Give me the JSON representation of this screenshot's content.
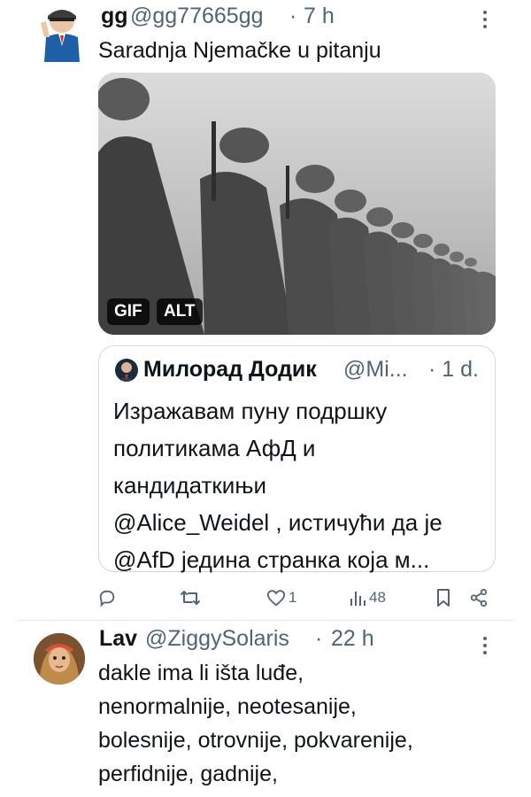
{
  "tweet1": {
    "name": "gg",
    "handle": "@gg77665gg",
    "sep": "·",
    "time": "7 h",
    "text": "Saradnja Njemačke u pitanju",
    "media": {
      "gif_badge": "GIF",
      "alt_badge": "ALT"
    },
    "quote": {
      "name": "Милорад Додик",
      "handle": "@Mi...",
      "time": "· 1 d.",
      "text": "Изражавам пуну подршку\nполитикама АфД и\nкандидаткињи\n@Alice_Weidel , истичући да је\n@AfD једина странка која м..."
    },
    "actions": {
      "likes": "1",
      "views": "48"
    }
  },
  "tweet2": {
    "name": "Lav",
    "handle": "@ZiggySolaris",
    "sep": "·",
    "time": "22 h",
    "text": "dakle ima li išta luđe,\nnenormalnije, neotesanije,\nbolesnije, otrovnije, pokvarenije,\nperfidnije, gadnije,"
  },
  "colors": {
    "text": "#0f1419",
    "secondary": "#536471",
    "border": "#cfd9de"
  },
  "icons": [
    "reply-icon",
    "retweet-icon",
    "like-icon",
    "views-icon",
    "bookmark-icon",
    "share-icon",
    "more-icon"
  ]
}
